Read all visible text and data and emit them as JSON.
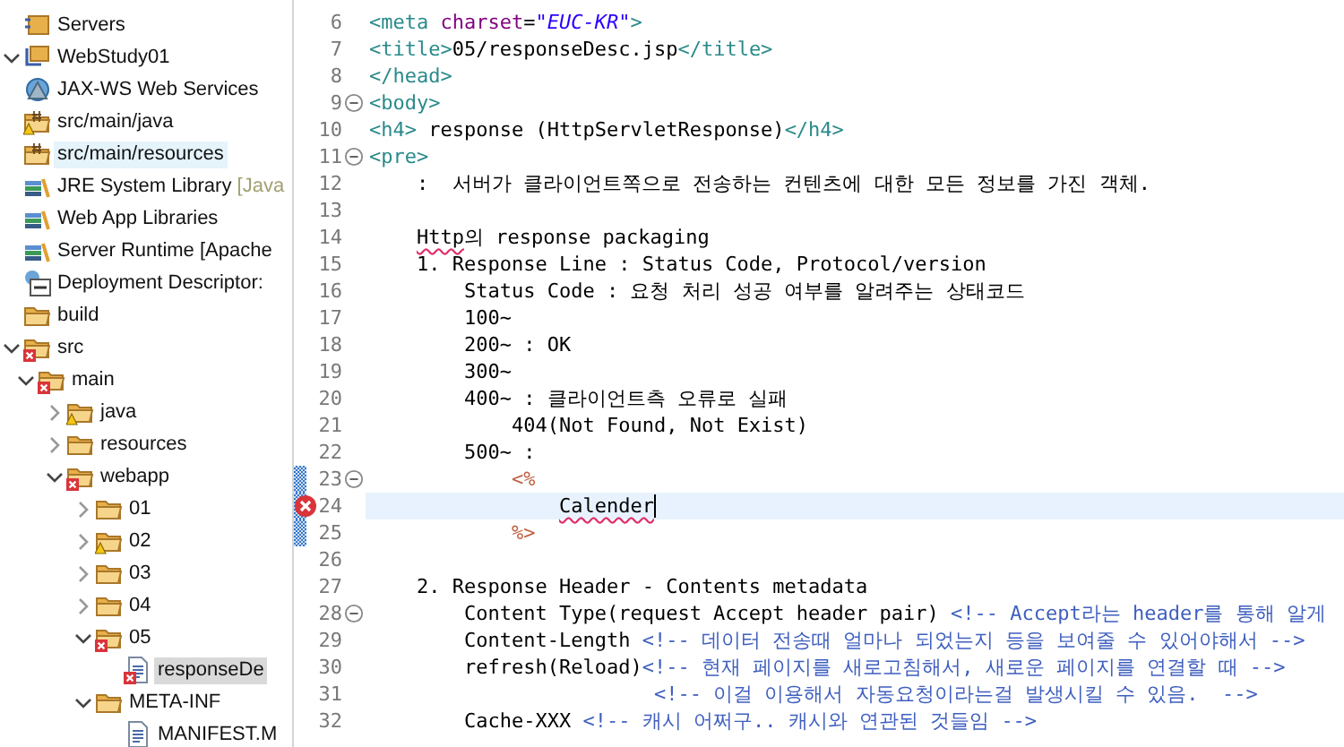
{
  "project_explorer": {
    "items": [
      {
        "label": "Servers",
        "kind": "server-project",
        "highlighted": false,
        "selected": false
      },
      {
        "label": "WebStudy01",
        "kind": "project",
        "expanded": true,
        "highlighted": false,
        "selected": false,
        "children": [
          {
            "label": "JAX-WS Web Services",
            "kind": "webservices",
            "highlighted": false,
            "selected": false
          },
          {
            "label": "src/main/java",
            "kind": "package-folder",
            "warning": true,
            "highlighted": false,
            "selected": false
          },
          {
            "label": "src/main/resources",
            "kind": "package-folder",
            "highlighted": true,
            "selected": false
          },
          {
            "label": "JRE System Library",
            "decoration": "[Java",
            "kind": "library",
            "highlighted": false,
            "selected": false
          },
          {
            "label": "Web App Libraries",
            "kind": "library",
            "highlighted": false,
            "selected": false
          },
          {
            "label": "Server Runtime [Apache",
            "kind": "library",
            "highlighted": false,
            "selected": false
          },
          {
            "label": "Deployment Descriptor:",
            "kind": "descriptor",
            "highlighted": false,
            "selected": false
          },
          {
            "label": "build",
            "kind": "folder",
            "highlighted": false,
            "selected": false
          },
          {
            "label": "src",
            "kind": "folder",
            "error": true,
            "expanded": true,
            "highlighted": false,
            "selected": false,
            "children": [
              {
                "label": "main",
                "kind": "folder",
                "error": true,
                "expanded": true,
                "highlighted": false,
                "selected": false,
                "children": [
                  {
                    "label": "java",
                    "kind": "folder",
                    "warning": true,
                    "expanded": false,
                    "highlighted": false,
                    "selected": false
                  },
                  {
                    "label": "resources",
                    "kind": "folder",
                    "expanded": false,
                    "highlighted": false,
                    "selected": false
                  },
                  {
                    "label": "webapp",
                    "kind": "folder",
                    "error": true,
                    "expanded": true,
                    "highlighted": false,
                    "selected": false,
                    "children": [
                      {
                        "label": "01",
                        "kind": "folder",
                        "expanded": false,
                        "highlighted": false,
                        "selected": false
                      },
                      {
                        "label": "02",
                        "kind": "folder",
                        "warning": true,
                        "expanded": false,
                        "highlighted": false,
                        "selected": false
                      },
                      {
                        "label": "03",
                        "kind": "folder",
                        "expanded": false,
                        "highlighted": false,
                        "selected": false
                      },
                      {
                        "label": "04",
                        "kind": "folder",
                        "expanded": false,
                        "highlighted": false,
                        "selected": false
                      },
                      {
                        "label": "05",
                        "kind": "folder",
                        "error": true,
                        "expanded": true,
                        "highlighted": false,
                        "selected": false,
                        "children": [
                          {
                            "label": "responseDe",
                            "kind": "file",
                            "error": true,
                            "highlighted": false,
                            "selected": true
                          }
                        ]
                      },
                      {
                        "label": "META-INF",
                        "kind": "folder",
                        "expanded": true,
                        "highlighted": false,
                        "selected": false,
                        "children": [
                          {
                            "label": "MANIFEST.M",
                            "kind": "file",
                            "highlighted": false,
                            "selected": false
                          }
                        ]
                      }
                    ]
                  }
                ]
              }
            ]
          }
        ]
      }
    ]
  },
  "editor": {
    "lines": [
      {
        "number": "6",
        "fold": false,
        "changed": false,
        "error": false,
        "current": false,
        "segments": [
          {
            "kind": "tag",
            "text": "<meta "
          },
          {
            "kind": "attr",
            "text": "charset"
          },
          {
            "kind": "text",
            "text": "="
          },
          {
            "kind": "value",
            "text": "\"EUC-KR\""
          },
          {
            "kind": "tag",
            "text": ">"
          }
        ]
      },
      {
        "number": "7",
        "fold": false,
        "changed": false,
        "error": false,
        "current": false,
        "segments": [
          {
            "kind": "tag",
            "text": "<title>"
          },
          {
            "kind": "text",
            "text": "05/responseDesc.jsp"
          },
          {
            "kind": "tag",
            "text": "</title>"
          }
        ]
      },
      {
        "number": "8",
        "fold": false,
        "changed": false,
        "error": false,
        "current": false,
        "segments": [
          {
            "kind": "tag",
            "text": "</head>"
          }
        ]
      },
      {
        "number": "9",
        "fold": true,
        "changed": false,
        "error": false,
        "current": false,
        "segments": [
          {
            "kind": "tag",
            "text": "<body>"
          }
        ]
      },
      {
        "number": "10",
        "fold": false,
        "changed": false,
        "error": false,
        "current": false,
        "segments": [
          {
            "kind": "tag",
            "text": "<h4>"
          },
          {
            "kind": "text",
            "text": " response (HttpServletResponse)"
          },
          {
            "kind": "tag",
            "text": "</h4>"
          }
        ]
      },
      {
        "number": "11",
        "fold": true,
        "changed": false,
        "error": false,
        "current": false,
        "segments": [
          {
            "kind": "tag",
            "text": "<pre>"
          }
        ]
      },
      {
        "number": "12",
        "fold": false,
        "changed": false,
        "error": false,
        "current": false,
        "segments": [
          {
            "kind": "text",
            "text": "    :  서버가 클라이언트쪽으로 전송하는 컨텐츠에 대한 모든 정보를 가진 객체."
          }
        ]
      },
      {
        "number": "13",
        "fold": false,
        "changed": false,
        "error": false,
        "current": false
      },
      {
        "number": "14",
        "fold": false,
        "changed": false,
        "error": false,
        "current": false,
        "segments": [
          {
            "kind": "text",
            "text": "    Http",
            "squiggle": true
          },
          {
            "kind": "text",
            "text": "의 response packaging"
          }
        ]
      },
      {
        "number": "15",
        "fold": false,
        "changed": false,
        "error": false,
        "current": false,
        "segments": [
          {
            "kind": "text",
            "text": "    1. Response Line : Status Code, Protocol/version"
          }
        ]
      },
      {
        "number": "16",
        "fold": false,
        "changed": false,
        "error": false,
        "current": false,
        "segments": [
          {
            "kind": "text",
            "text": "        Status Code : 요청 처리 성공 여부를 알려주는 상태코드"
          }
        ]
      },
      {
        "number": "17",
        "fold": false,
        "changed": false,
        "error": false,
        "current": false,
        "segments": [
          {
            "kind": "text",
            "text": "        100~"
          }
        ]
      },
      {
        "number": "18",
        "fold": false,
        "changed": false,
        "error": false,
        "current": false,
        "segments": [
          {
            "kind": "text",
            "text": "        200~ : OK"
          }
        ]
      },
      {
        "number": "19",
        "fold": false,
        "changed": false,
        "error": false,
        "current": false,
        "segments": [
          {
            "kind": "text",
            "text": "        300~"
          }
        ]
      },
      {
        "number": "20",
        "fold": false,
        "changed": false,
        "error": false,
        "current": false,
        "segments": [
          {
            "kind": "text",
            "text": "        400~ : 클라이언트측 오류로 실패"
          }
        ]
      },
      {
        "number": "21",
        "fold": false,
        "changed": false,
        "error": false,
        "current": false,
        "segments": [
          {
            "kind": "text",
            "text": "            404(Not Found, Not Exist)"
          }
        ]
      },
      {
        "number": "22",
        "fold": false,
        "changed": false,
        "error": false,
        "current": false,
        "segments": [
          {
            "kind": "text",
            "text": "        500~ :"
          }
        ]
      },
      {
        "number": "23",
        "fold": true,
        "changed": true,
        "error": false,
        "current": false,
        "segments": [
          {
            "kind": "jsp",
            "text": "            <%"
          }
        ]
      },
      {
        "number": "24",
        "fold": false,
        "changed": true,
        "error": true,
        "current": true,
        "segments": [
          {
            "kind": "text",
            "text": "                Calender",
            "squiggle": true
          }
        ]
      },
      {
        "number": "25",
        "fold": false,
        "changed": true,
        "error": false,
        "current": false,
        "segments": [
          {
            "kind": "jsp",
            "text": "            %>"
          }
        ]
      },
      {
        "number": "26",
        "fold": false,
        "changed": false,
        "error": false,
        "current": false
      },
      {
        "number": "27",
        "fold": false,
        "changed": false,
        "error": false,
        "current": false,
        "segments": [
          {
            "kind": "text",
            "text": "    2. Response Header - Contents metadata"
          }
        ]
      },
      {
        "number": "28",
        "fold": true,
        "changed": false,
        "error": false,
        "current": false,
        "segments": [
          {
            "kind": "text",
            "text": "        Content Type(request Accept header pair) "
          },
          {
            "kind": "comment",
            "text": "<!-- Accept라는 header를 통해 알게"
          }
        ]
      },
      {
        "number": "29",
        "fold": false,
        "changed": false,
        "error": false,
        "current": false,
        "segments": [
          {
            "kind": "text",
            "text": "        Content-Length "
          },
          {
            "kind": "comment",
            "text": "<!-- 데이터 전송때 얼마나 되었는지 등을 보여줄 수 있어야해서 -->"
          }
        ]
      },
      {
        "number": "30",
        "fold": false,
        "changed": false,
        "error": false,
        "current": false,
        "segments": [
          {
            "kind": "text",
            "text": "        refresh(Reload)"
          },
          {
            "kind": "comment",
            "text": "<!-- 현재 페이지를 새로고침해서, 새로운 페이지를 연결할 때 -->"
          }
        ]
      },
      {
        "number": "31",
        "fold": false,
        "changed": false,
        "error": false,
        "current": false,
        "segments": [
          {
            "kind": "comment",
            "text": "                        <!-- 이걸 이용해서 자동요청이라는걸 발생시킬 수 있음.  -->"
          }
        ]
      },
      {
        "number": "32",
        "fold": false,
        "changed": false,
        "error": false,
        "current": false,
        "segments": [
          {
            "kind": "text",
            "text": "        Cache-XXX "
          },
          {
            "kind": "comment",
            "text": "<!-- 캐시 어쩌구.. 캐시와 연관된 것들임 -->"
          }
        ]
      }
    ]
  }
}
